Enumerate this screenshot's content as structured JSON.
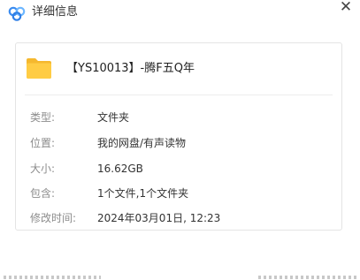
{
  "window": {
    "title": "详细信息",
    "close_glyph": "✕",
    "app_icon": "baidu-netdisk-logo-icon",
    "close_icon": "close-icon"
  },
  "file": {
    "icon": "folder-icon",
    "name": "【YS10013】-腾F五Q年"
  },
  "properties": {
    "type": {
      "label": "类型:",
      "value": "文件夹"
    },
    "location": {
      "label": "位置:",
      "value": "我的网盘/有声读物"
    },
    "size": {
      "label": "大小:",
      "value": "16.62GB"
    },
    "contains": {
      "label": "包含:",
      "value": "1个文件,1个文件夹"
    },
    "modified": {
      "label": "修改时间:",
      "value": "2024年03月01日, 12:23"
    }
  },
  "colors": {
    "folder": "#f5b82e",
    "folder_front": "#ffcc44",
    "logo_blue": "#3b8cf0",
    "logo_light": "#6cb6ff",
    "label_gray": "#8c8c8c"
  }
}
